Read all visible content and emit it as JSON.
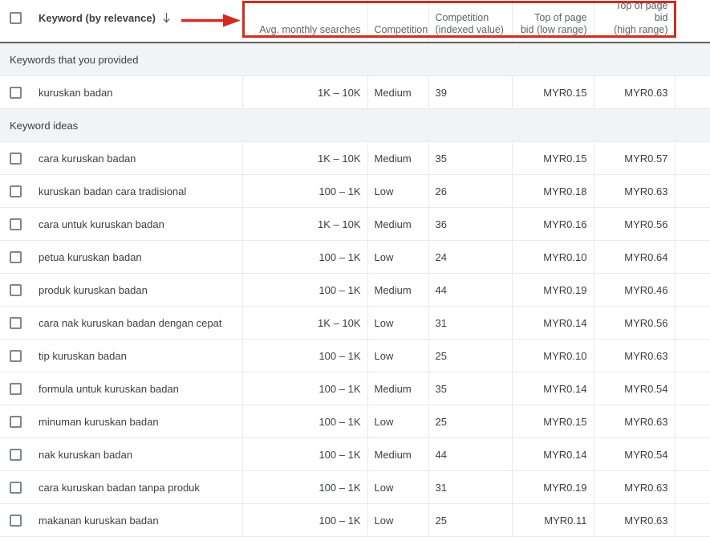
{
  "table": {
    "headers": {
      "keyword": "Keyword (by relevance)",
      "sort_icon": "arrow-down-icon",
      "avg_monthly_searches": "Avg. monthly searches",
      "competition": "Competition",
      "competition_indexed_line1": "Competition",
      "competition_indexed_line2": "(indexed value)",
      "top_of_page_bid_low_line1": "Top of page",
      "top_of_page_bid_low_line2": "bid (low range)",
      "top_of_page_bid_high_line1": "Top of page bid",
      "top_of_page_bid_high_line2": "(high range)"
    },
    "sections": [
      {
        "label": "Keywords that you provided",
        "rows": [
          {
            "keyword": "kuruskan badan",
            "avg_monthly_searches": "1K – 10K",
            "competition": "Medium",
            "competition_indexed": "39",
            "bid_low": "MYR0.15",
            "bid_high": "MYR0.63"
          }
        ]
      },
      {
        "label": "Keyword ideas",
        "rows": [
          {
            "keyword": "cara kuruskan badan",
            "avg_monthly_searches": "1K – 10K",
            "competition": "Medium",
            "competition_indexed": "35",
            "bid_low": "MYR0.15",
            "bid_high": "MYR0.57"
          },
          {
            "keyword": "kuruskan badan cara tradisional",
            "avg_monthly_searches": "100 – 1K",
            "competition": "Low",
            "competition_indexed": "26",
            "bid_low": "MYR0.18",
            "bid_high": "MYR0.63"
          },
          {
            "keyword": "cara untuk kuruskan badan",
            "avg_monthly_searches": "1K – 10K",
            "competition": "Medium",
            "competition_indexed": "36",
            "bid_low": "MYR0.16",
            "bid_high": "MYR0.56"
          },
          {
            "keyword": "petua kuruskan badan",
            "avg_monthly_searches": "100 – 1K",
            "competition": "Low",
            "competition_indexed": "24",
            "bid_low": "MYR0.10",
            "bid_high": "MYR0.64"
          },
          {
            "keyword": "produk kuruskan badan",
            "avg_monthly_searches": "100 – 1K",
            "competition": "Medium",
            "competition_indexed": "44",
            "bid_low": "MYR0.19",
            "bid_high": "MYR0.46"
          },
          {
            "keyword": "cara nak kuruskan badan dengan cepat",
            "avg_monthly_searches": "1K – 10K",
            "competition": "Low",
            "competition_indexed": "31",
            "bid_low": "MYR0.14",
            "bid_high": "MYR0.56"
          },
          {
            "keyword": "tip kuruskan badan",
            "avg_monthly_searches": "100 – 1K",
            "competition": "Low",
            "competition_indexed": "25",
            "bid_low": "MYR0.10",
            "bid_high": "MYR0.63"
          },
          {
            "keyword": "formula untuk kuruskan badan",
            "avg_monthly_searches": "100 – 1K",
            "competition": "Medium",
            "competition_indexed": "35",
            "bid_low": "MYR0.14",
            "bid_high": "MYR0.54"
          },
          {
            "keyword": "minuman kuruskan badan",
            "avg_monthly_searches": "100 – 1K",
            "competition": "Low",
            "competition_indexed": "25",
            "bid_low": "MYR0.15",
            "bid_high": "MYR0.63"
          },
          {
            "keyword": "nak kuruskan badan",
            "avg_monthly_searches": "100 – 1K",
            "competition": "Medium",
            "competition_indexed": "44",
            "bid_low": "MYR0.14",
            "bid_high": "MYR0.54"
          },
          {
            "keyword": "cara kuruskan badan tanpa produk",
            "avg_monthly_searches": "100 – 1K",
            "competition": "Low",
            "competition_indexed": "31",
            "bid_low": "MYR0.19",
            "bid_high": "MYR0.63"
          },
          {
            "keyword": "makanan kuruskan badan",
            "avg_monthly_searches": "100 – 1K",
            "competition": "Low",
            "competition_indexed": "25",
            "bid_low": "MYR0.11",
            "bid_high": "MYR0.63"
          }
        ]
      }
    ]
  },
  "annotation": {
    "highlight_color": "#d32b20",
    "arrow_icon": "arrow-right-icon",
    "highlight_target": "Avg. monthly searches"
  }
}
